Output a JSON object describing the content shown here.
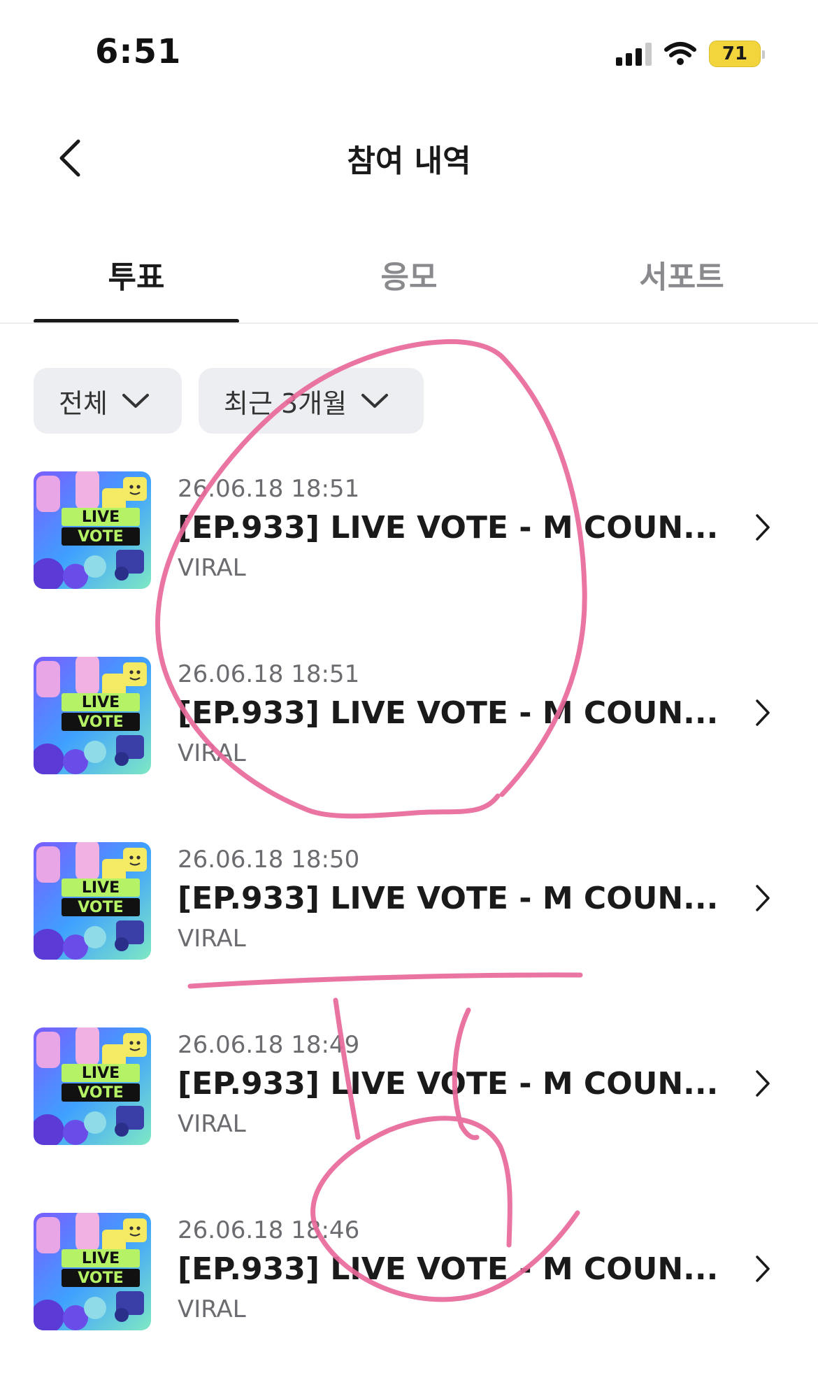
{
  "status_bar": {
    "time": "6:51",
    "battery": "71"
  },
  "header": {
    "title": "참여 내역"
  },
  "tabs": [
    {
      "label": "투표",
      "active": true
    },
    {
      "label": "응모",
      "active": false
    },
    {
      "label": "서포트",
      "active": false
    }
  ],
  "filters": [
    {
      "label": "전체"
    },
    {
      "label": "최근 3개월"
    }
  ],
  "items": [
    {
      "date": "26.06.18 18:51",
      "title": "[EP.933] LIVE VOTE - M COUN...",
      "sub": "VIRAL",
      "thumb_text": [
        "LIVE",
        "VOTE"
      ]
    },
    {
      "date": "26.06.18 18:51",
      "title": "[EP.933] LIVE VOTE - M COUN...",
      "sub": "VIRAL",
      "thumb_text": [
        "LIVE",
        "VOTE"
      ]
    },
    {
      "date": "26.06.18 18:50",
      "title": "[EP.933] LIVE VOTE - M COUN...",
      "sub": "VIRAL",
      "thumb_text": [
        "LIVE",
        "VOTE"
      ]
    },
    {
      "date": "26.06.18 18:49",
      "title": "[EP.933] LIVE VOTE - M COUN...",
      "sub": "VIRAL",
      "thumb_text": [
        "LIVE",
        "VOTE"
      ]
    },
    {
      "date": "26.06.18 18:46",
      "title": "[EP.933] LIVE VOTE - M COUN...",
      "sub": "VIRAL",
      "thumb_text": [
        "LIVE",
        "VOTE"
      ]
    }
  ],
  "colors": {
    "annotation": "#e8689a",
    "battery": "#f2d53c",
    "active_tab": "#1a1a1a",
    "inactive_tab": "#8a8a8e"
  }
}
